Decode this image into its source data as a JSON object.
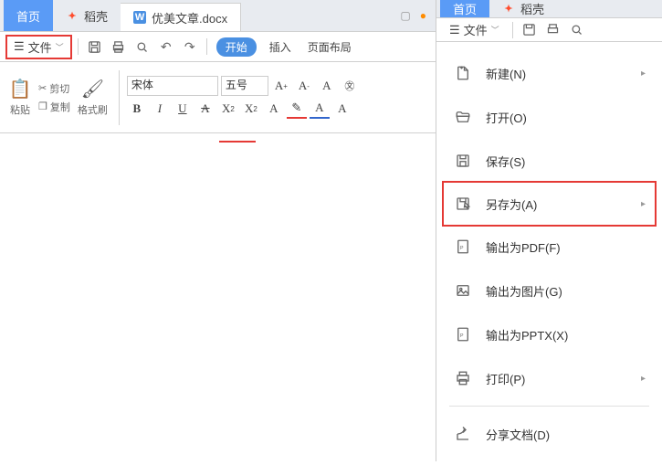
{
  "left": {
    "tabs": {
      "home": "首页",
      "dao": "稻壳",
      "doc": "优美文章.docx"
    },
    "file_label": "文件",
    "menu": {
      "start": "开始",
      "insert": "插入",
      "page_layout": "页面布局"
    },
    "clipboard": {
      "cut": "剪切",
      "copy": "复制",
      "paste": "粘贴",
      "format_painter": "格式刷"
    },
    "font": {
      "name": "宋体",
      "size": "五号"
    },
    "fmt": {
      "bold": "B",
      "italic": "I",
      "underline": "U",
      "strike": "S",
      "sup": "X",
      "sub": "X",
      "a_caps": "A",
      "a_high": "A",
      "a_color": "A",
      "a_clear": "A"
    }
  },
  "right": {
    "tabs": {
      "home": "首页",
      "dao": "稻壳"
    },
    "file_label": "文件",
    "menu": [
      {
        "label": "新建(N)",
        "chevron": true
      },
      {
        "label": "打开(O)",
        "chevron": false
      },
      {
        "label": "保存(S)",
        "chevron": false
      },
      {
        "label": "另存为(A)",
        "chevron": true,
        "highlight": true
      },
      {
        "label": "输出为PDF(F)",
        "chevron": false
      },
      {
        "label": "输出为图片(G)",
        "chevron": false
      },
      {
        "label": "输出为PPTX(X)",
        "chevron": false
      },
      {
        "label": "打印(P)",
        "chevron": true
      },
      {
        "label": "分享文档(D)",
        "chevron": false
      }
    ]
  }
}
